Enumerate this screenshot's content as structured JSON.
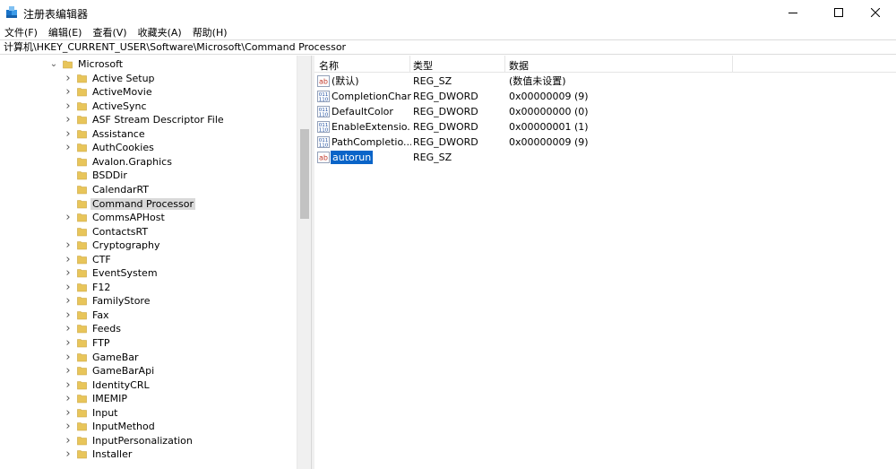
{
  "window": {
    "title": "注册表编辑器"
  },
  "menu": [
    "文件(F)",
    "编辑(E)",
    "查看(V)",
    "收藏夹(A)",
    "帮助(H)"
  ],
  "address": "计算机\\HKEY_CURRENT_USER\\Software\\Microsoft\\Command Processor",
  "tree": {
    "parent": "Microsoft",
    "items": [
      {
        "label": "Active Setup",
        "expandable": true
      },
      {
        "label": "ActiveMovie",
        "expandable": true
      },
      {
        "label": "ActiveSync",
        "expandable": true
      },
      {
        "label": "ASF Stream Descriptor File",
        "expandable": true
      },
      {
        "label": "Assistance",
        "expandable": true
      },
      {
        "label": "AuthCookies",
        "expandable": true
      },
      {
        "label": "Avalon.Graphics",
        "expandable": false
      },
      {
        "label": "BSDDir",
        "expandable": false
      },
      {
        "label": "CalendarRT",
        "expandable": false
      },
      {
        "label": "Command Processor",
        "expandable": false,
        "selected": true
      },
      {
        "label": "CommsAPHost",
        "expandable": true
      },
      {
        "label": "ContactsRT",
        "expandable": false
      },
      {
        "label": "Cryptography",
        "expandable": true
      },
      {
        "label": "CTF",
        "expandable": true
      },
      {
        "label": "EventSystem",
        "expandable": true
      },
      {
        "label": "F12",
        "expandable": true
      },
      {
        "label": "FamilyStore",
        "expandable": true
      },
      {
        "label": "Fax",
        "expandable": true
      },
      {
        "label": "Feeds",
        "expandable": true
      },
      {
        "label": "FTP",
        "expandable": true
      },
      {
        "label": "GameBar",
        "expandable": true
      },
      {
        "label": "GameBarApi",
        "expandable": true
      },
      {
        "label": "IdentityCRL",
        "expandable": true
      },
      {
        "label": "IMEMIP",
        "expandable": true
      },
      {
        "label": "Input",
        "expandable": true
      },
      {
        "label": "InputMethod",
        "expandable": true
      },
      {
        "label": "InputPersonalization",
        "expandable": true
      },
      {
        "label": "Installer",
        "expandable": true
      }
    ]
  },
  "list": {
    "columns": [
      "名称",
      "类型",
      "数据"
    ],
    "rows": [
      {
        "icon": "string",
        "name": "(默认)",
        "type": "REG_SZ",
        "data": "(数值未设置)"
      },
      {
        "icon": "binary",
        "name": "CompletionChar",
        "type": "REG_DWORD",
        "data": "0x00000009 (9)"
      },
      {
        "icon": "binary",
        "name": "DefaultColor",
        "type": "REG_DWORD",
        "data": "0x00000000 (0)"
      },
      {
        "icon": "binary",
        "name": "EnableExtensio...",
        "type": "REG_DWORD",
        "data": "0x00000001 (1)"
      },
      {
        "icon": "binary",
        "name": "PathCompletio...",
        "type": "REG_DWORD",
        "data": "0x00000009 (9)"
      },
      {
        "icon": "string",
        "name": "autorun",
        "type": "REG_SZ",
        "data": "",
        "editing": true
      }
    ]
  },
  "colors": {
    "selection": "#0a64c8",
    "tree_selected": "#d9d9d9",
    "folder": "#e8c55a"
  }
}
